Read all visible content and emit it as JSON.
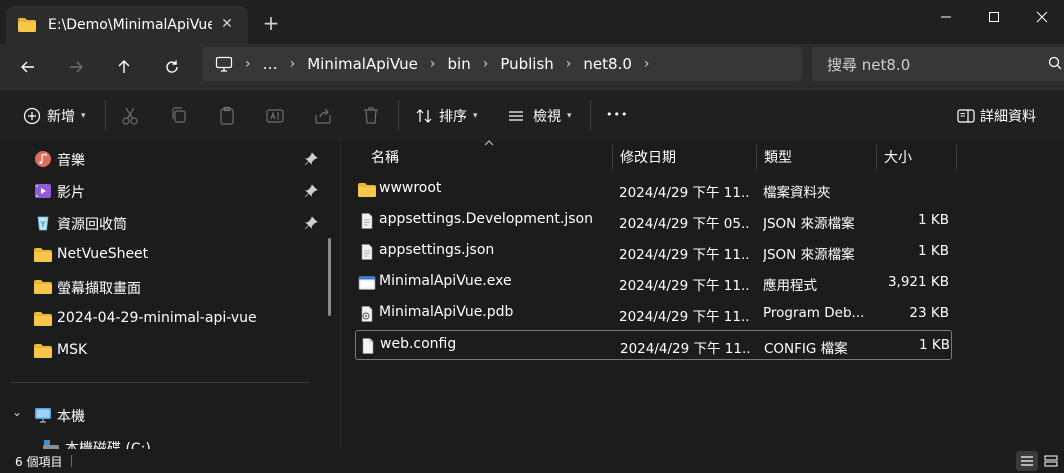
{
  "window": {
    "tab_title": "E:\\Demo\\MinimalApiVue\\",
    "new_tab_label": "+",
    "minimize_glyph": "—",
    "maximize_glyph": "□",
    "close_glyph": "✕"
  },
  "nav": {
    "breadcrumbs": [
      "…",
      "MinimalApiVue",
      "bin",
      "Publish",
      "net8.0"
    ],
    "search_placeholder": "搜尋 net8.0"
  },
  "toolbar": {
    "new_label": "新增",
    "sort_label": "排序",
    "view_label": "檢視",
    "more_label": "•••",
    "details_label": "詳細資料"
  },
  "sidebar": {
    "items": [
      {
        "label": "音樂",
        "icon": "music-icon",
        "pinned": true
      },
      {
        "label": "影片",
        "icon": "video-icon",
        "pinned": true
      },
      {
        "label": "資源回收筒",
        "icon": "recycle-bin-icon",
        "pinned": true
      },
      {
        "label": "NetVueSheet",
        "icon": "folder-icon",
        "pinned": false
      },
      {
        "label": "螢幕擷取畫面",
        "icon": "folder-icon",
        "pinned": false
      },
      {
        "label": "2024-04-29-minimal-api-vue",
        "icon": "folder-icon",
        "pinned": false
      },
      {
        "label": "MSK",
        "icon": "folder-icon",
        "pinned": false
      }
    ],
    "this_pc_label": "本機",
    "drive_label": "本機磁碟 (C:)"
  },
  "columns": {
    "name": "名稱",
    "date": "修改日期",
    "type": "類型",
    "size": "大小"
  },
  "files": [
    {
      "name": "wwwroot",
      "date": "2024/4/29 下午 11...",
      "type": "檔案資料夾",
      "size": "",
      "icon": "folder-icon"
    },
    {
      "name": "appsettings.Development.json",
      "date": "2024/4/29 下午 05...",
      "type": "JSON 來源檔案",
      "size": "1 KB",
      "icon": "json-file-icon"
    },
    {
      "name": "appsettings.json",
      "date": "2024/4/29 下午 11...",
      "type": "JSON 來源檔案",
      "size": "1 KB",
      "icon": "json-file-icon"
    },
    {
      "name": "MinimalApiVue.exe",
      "date": "2024/4/29 下午 11...",
      "type": "應用程式",
      "size": "3,921 KB",
      "icon": "exe-icon"
    },
    {
      "name": "MinimalApiVue.pdb",
      "date": "2024/4/29 下午 11...",
      "type": "Program Deb...",
      "size": "23 KB",
      "icon": "pdb-file-icon"
    },
    {
      "name": "web.config",
      "date": "2024/4/29 下午 11...",
      "type": "CONFIG 檔案",
      "size": "1 KB",
      "icon": "config-file-icon"
    }
  ],
  "status": {
    "item_count": "6 個項目"
  },
  "colors": {
    "folder": "#e8b739",
    "background": "#1c1c1c",
    "navbar": "#2c2c2c"
  }
}
